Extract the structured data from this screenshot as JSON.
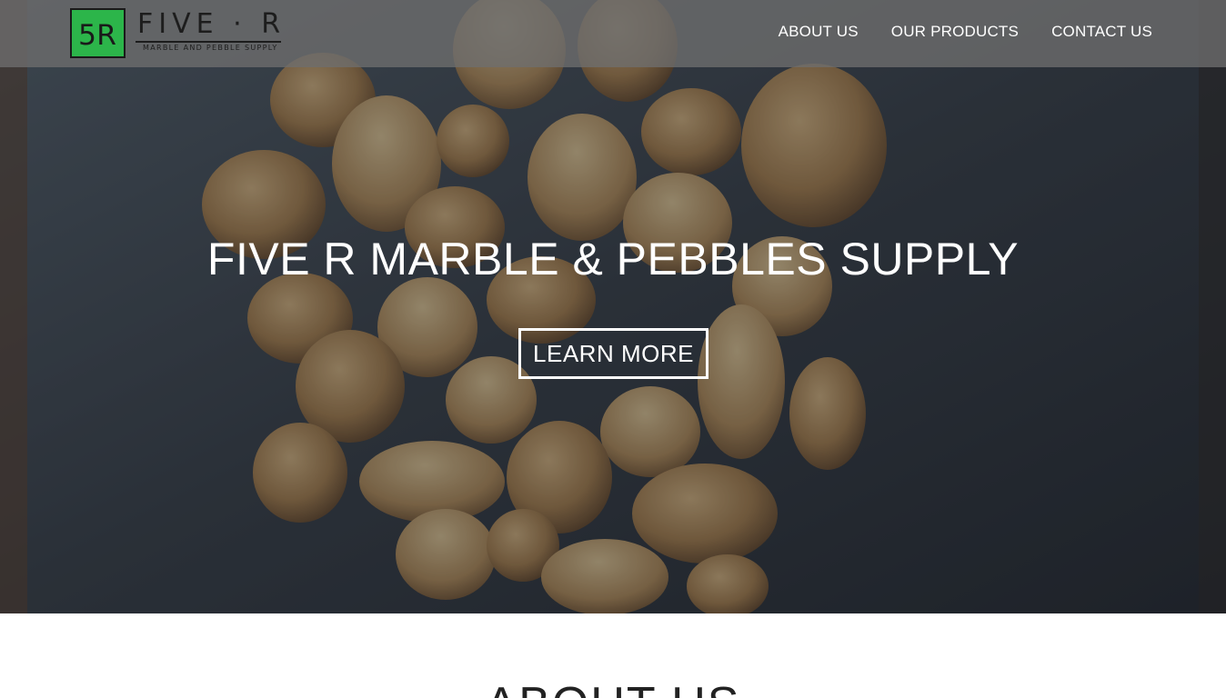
{
  "brand": {
    "monogram": "5R",
    "wordmark": "FIVE · R",
    "tagline": "MARBLE AND PEBBLE SUPPLY",
    "accent_color": "#2cb54a"
  },
  "nav": {
    "items": [
      {
        "label": "ABOUT US"
      },
      {
        "label": "OUR PRODUCTS"
      },
      {
        "label": "CONTACT US"
      }
    ]
  },
  "hero": {
    "title": "FIVE R MARBLE & PEBBLES SUPPLY",
    "cta_label": "LEARN MORE",
    "background_image": "pebbles-photo"
  },
  "about": {
    "heading": "ABOUT US"
  }
}
